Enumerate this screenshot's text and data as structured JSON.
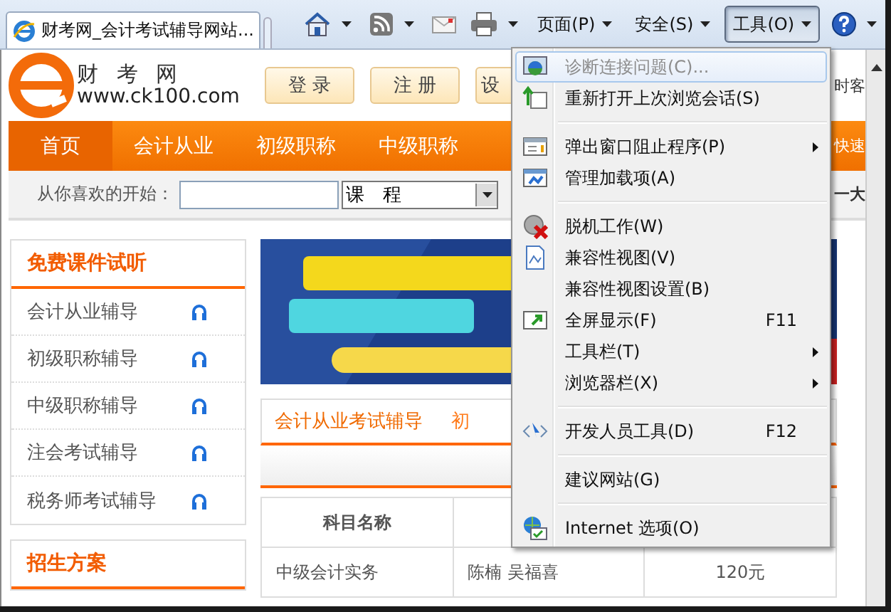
{
  "browser_tab": {
    "title": "财考网_会计考试辅导网站..."
  },
  "toolbar_menus": [
    {
      "label": "页面(P)",
      "selected": false
    },
    {
      "label": "安全(S)",
      "selected": false
    },
    {
      "label": "工具(O)",
      "selected": true
    }
  ],
  "header": {
    "logo_name": "财 考 网",
    "logo_url": "www.ck100.com",
    "buttons": [
      "登 录",
      "注 册",
      "设"
    ],
    "right_text": "时客"
  },
  "nav": {
    "items": [
      {
        "label": "首页",
        "selected": true
      },
      {
        "label": "会计从业",
        "selected": false
      },
      {
        "label": "初级职称",
        "selected": false
      },
      {
        "label": "中级职称",
        "selected": false
      }
    ],
    "right_text": "快速"
  },
  "search": {
    "label": "从你喜欢的开始：",
    "select_value": "课　程",
    "right_text": "一大"
  },
  "sidebar": {
    "title": "免费课件试听",
    "items": [
      "会计从业辅导",
      "初级职称辅导",
      "中级职称辅导",
      "注会考试辅导",
      "税务师考试辅导"
    ],
    "second_title": "招生方案"
  },
  "course_tabs": [
    {
      "label": "会计从业考试辅导",
      "selected": true
    },
    {
      "label": "初",
      "selected": false
    }
  ],
  "table": {
    "columns": [
      "科目名称"
    ],
    "rows": [
      [
        "中级会计实务",
        "陈楠 吴福喜",
        "120元"
      ]
    ]
  },
  "menu": {
    "items": [
      {
        "kind": "item",
        "label": "诊断连接问题(C)...",
        "disabled": true,
        "selected": true
      },
      {
        "kind": "item",
        "label": "重新打开上次浏览会话(S)",
        "disabled": false,
        "selected": false
      },
      {
        "kind": "separator"
      },
      {
        "kind": "item",
        "label": "弹出窗口阻止程序(P)",
        "submenu": true,
        "disabled": false,
        "selected": false
      },
      {
        "kind": "item",
        "label": "管理加载项(A)",
        "disabled": false,
        "selected": false
      },
      {
        "kind": "separator"
      },
      {
        "kind": "item",
        "label": "脱机工作(W)",
        "disabled": false,
        "selected": false
      },
      {
        "kind": "item",
        "label": "兼容性视图(V)",
        "disabled": false,
        "selected": false
      },
      {
        "kind": "item",
        "label": "兼容性视图设置(B)",
        "disabled": false,
        "selected": false
      },
      {
        "kind": "item",
        "label": "全屏显示(F)",
        "shortcut": "F11",
        "disabled": false,
        "selected": false
      },
      {
        "kind": "item",
        "label": "工具栏(T)",
        "submenu": true,
        "disabled": false,
        "selected": false
      },
      {
        "kind": "item",
        "label": "浏览器栏(X)",
        "submenu": true,
        "disabled": false,
        "selected": false
      },
      {
        "kind": "separator"
      },
      {
        "kind": "item",
        "label": "开发人员工具(D)",
        "shortcut": "F12",
        "disabled": false,
        "selected": false
      },
      {
        "kind": "separator"
      },
      {
        "kind": "item",
        "label": "建议网站(G)",
        "disabled": false,
        "selected": false
      },
      {
        "kind": "separator"
      },
      {
        "kind": "item",
        "label": "Internet 选项(O)",
        "disabled": false,
        "selected": false
      }
    ]
  }
}
